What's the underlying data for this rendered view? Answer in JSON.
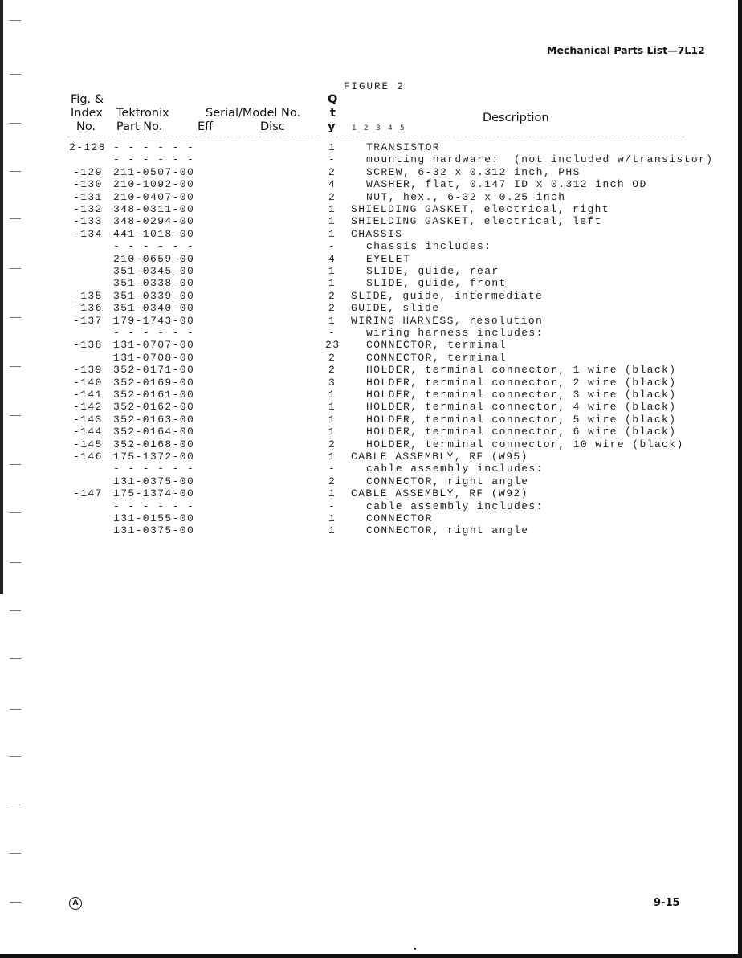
{
  "running_head": "Mechanical Parts List—7L12",
  "figure_label": "FIGURE 2",
  "headers": {
    "fig_amp": "Fig. &",
    "index": "Index",
    "index_no": "No.",
    "tektronix": "Tektronix",
    "part_no": "Part No.",
    "serial_model": "Serial/Model No.",
    "eff": "Eff",
    "disc": "Disc",
    "qty_q": "Q",
    "qty_t": "t",
    "qty_y": "y",
    "description": "Description",
    "indent_levels": [
      "1",
      "2",
      "3",
      "4",
      "5"
    ]
  },
  "rows": [
    {
      "index": "2-128",
      "part": "- - - - - -",
      "qty": "1",
      "desc": "TRANSISTOR",
      "indent": 1
    },
    {
      "index": "",
      "part": "- - - - - -",
      "qty": "-",
      "desc": "mounting hardware:  (not included w/transistor)",
      "indent": 1
    },
    {
      "index": "-129",
      "part": "211-0507-00",
      "qty": "2",
      "desc": "SCREW, 6-32 x 0.312 inch, PHS",
      "indent": 1
    },
    {
      "index": "-130",
      "part": "210-1092-00",
      "qty": "4",
      "desc": "WASHER, flat, 0.147 ID x 0.312 inch OD",
      "indent": 1
    },
    {
      "index": "-131",
      "part": "210-0407-00",
      "qty": "2",
      "desc": "NUT, hex., 6-32 x 0.25 inch",
      "indent": 1
    },
    {
      "index": "-132",
      "part": "348-0311-00",
      "qty": "1",
      "desc": "SHIELDING GASKET, electrical, right",
      "indent": 0
    },
    {
      "index": "-133",
      "part": "348-0294-00",
      "qty": "1",
      "desc": "SHIELDING GASKET, electrical, left",
      "indent": 0
    },
    {
      "index": "-134",
      "part": "441-1018-00",
      "qty": "1",
      "desc": "CHASSIS",
      "indent": 0
    },
    {
      "index": "",
      "part": "- - - - - -",
      "qty": "-",
      "desc": "chassis includes:",
      "indent": 1
    },
    {
      "index": "",
      "part": "210-0659-00",
      "qty": "4",
      "desc": "EYELET",
      "indent": 1
    },
    {
      "index": "",
      "part": "351-0345-00",
      "qty": "1",
      "desc": "SLIDE, guide, rear",
      "indent": 1
    },
    {
      "index": "",
      "part": "351-0338-00",
      "qty": "1",
      "desc": "SLIDE, guide, front",
      "indent": 1
    },
    {
      "index": "-135",
      "part": "351-0339-00",
      "qty": "2",
      "desc": "SLIDE, guide, intermediate",
      "indent": 0
    },
    {
      "index": "-136",
      "part": "351-0340-00",
      "qty": "2",
      "desc": "GUIDE, slide",
      "indent": 0
    },
    {
      "index": "-137",
      "part": "179-1743-00",
      "qty": "1",
      "desc": "WIRING HARNESS, resolution",
      "indent": 0
    },
    {
      "index": "",
      "part": "- - - - - -",
      "qty": "-",
      "desc": "wiring harness includes:",
      "indent": 1
    },
    {
      "index": "-138",
      "part": "131-0707-00",
      "qty": "23",
      "desc": "CONNECTOR, terminal",
      "indent": 1
    },
    {
      "index": "",
      "part": "131-0708-00",
      "qty": "2",
      "desc": "CONNECTOR, terminal",
      "indent": 1
    },
    {
      "index": "-139",
      "part": "352-0171-00",
      "qty": "2",
      "desc": "HOLDER, terminal connector, 1 wire (black)",
      "indent": 1
    },
    {
      "index": "-140",
      "part": "352-0169-00",
      "qty": "3",
      "desc": "HOLDER, terminal connector, 2 wire (black)",
      "indent": 1
    },
    {
      "index": "-141",
      "part": "352-0161-00",
      "qty": "1",
      "desc": "HOLDER, terminal connector, 3 wire (black)",
      "indent": 1
    },
    {
      "index": "-142",
      "part": "352-0162-00",
      "qty": "1",
      "desc": "HOLDER, terminal connector, 4 wire (black)",
      "indent": 1
    },
    {
      "index": "-143",
      "part": "352-0163-00",
      "qty": "1",
      "desc": "HOLDER, terminal connector, 5 wire (black)",
      "indent": 1
    },
    {
      "index": "-144",
      "part": "352-0164-00",
      "qty": "1",
      "desc": "HOLDER, terminal connector, 6 wire (black)",
      "indent": 1
    },
    {
      "index": "-145",
      "part": "352-0168-00",
      "qty": "2",
      "desc": "HOLDER, terminal connector, 10 wire (black)",
      "indent": 1
    },
    {
      "index": "-146",
      "part": "175-1372-00",
      "qty": "1",
      "desc": "CABLE ASSEMBLY, RF (W95)",
      "indent": 0
    },
    {
      "index": "",
      "part": "- - - - - -",
      "qty": "-",
      "desc": "cable assembly includes:",
      "indent": 1
    },
    {
      "index": "",
      "part": "131-0375-00",
      "qty": "2",
      "desc": "CONNECTOR, right angle",
      "indent": 1
    },
    {
      "index": "-147",
      "part": "175-1374-00",
      "qty": "1",
      "desc": "CABLE ASSEMBLY, RF (W92)",
      "indent": 0
    },
    {
      "index": "",
      "part": "- - - - - -",
      "qty": "-",
      "desc": "cable assembly includes:",
      "indent": 1
    },
    {
      "index": "",
      "part": "131-0155-00",
      "qty": "1",
      "desc": "CONNECTOR",
      "indent": 1
    },
    {
      "index": "",
      "part": "131-0375-00",
      "qty": "1",
      "desc": "CONNECTOR, right angle",
      "indent": 1
    }
  ],
  "footer": {
    "revision_mark": "A",
    "page_number": "9-15"
  }
}
